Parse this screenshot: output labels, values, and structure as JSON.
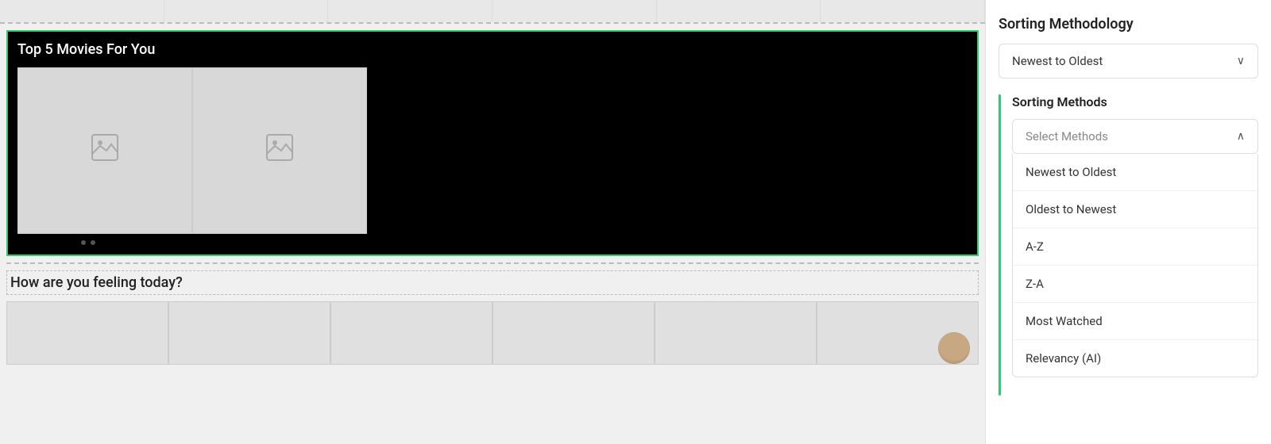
{
  "main": {
    "movies_section": {
      "title": "Top 5 Movies For You",
      "thumbnails": [
        {
          "id": 1
        },
        {
          "id": 2
        }
      ],
      "dots": [
        1,
        2
      ]
    },
    "feeling_section": {
      "title": "How are you feeling today?",
      "thumbs": [
        1,
        2,
        3,
        4,
        5,
        6
      ]
    },
    "top_strip_items": [
      1,
      2,
      3,
      4,
      5,
      6
    ]
  },
  "sidebar": {
    "sorting_methodology": {
      "title": "Sorting Methodology",
      "selected_value": "Newest to Oldest",
      "chevron_down": "∨"
    },
    "sorting_methods": {
      "title": "Sorting Methods",
      "select_methods_placeholder": "Select Methods",
      "chevron_up": "∧",
      "options": [
        {
          "label": "Newest to Oldest"
        },
        {
          "label": "Oldest to Newest"
        },
        {
          "label": "A-Z"
        },
        {
          "label": "Z-A"
        },
        {
          "label": "Most Watched"
        },
        {
          "label": "Relevancy (AI)"
        }
      ]
    }
  }
}
